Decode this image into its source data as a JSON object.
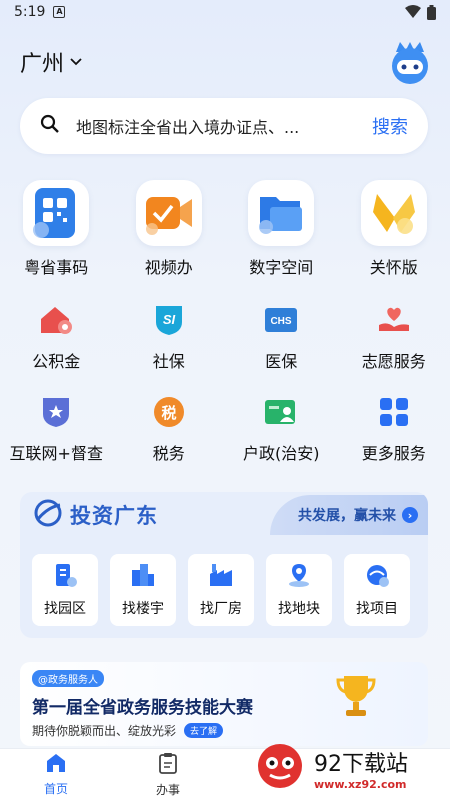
{
  "status_bar": {
    "time": "5:19",
    "notif_letter": "A"
  },
  "header": {
    "city": "广州"
  },
  "search": {
    "placeholder": "地图标注全省出入境办证点、...",
    "button": "搜索"
  },
  "main_services": [
    {
      "label": "粤省事码",
      "icon": "qr-code-icon"
    },
    {
      "label": "视频办",
      "icon": "video-icon"
    },
    {
      "label": "数字空间",
      "icon": "folder-icon"
    },
    {
      "label": "关怀版",
      "icon": "ribbon-icon"
    }
  ],
  "sub_services": [
    {
      "label": "公积金",
      "icon": "house-fund-icon"
    },
    {
      "label": "社保",
      "icon": "social-security-icon"
    },
    {
      "label": "医保",
      "icon": "medical-insurance-icon"
    },
    {
      "label": "志愿服务",
      "icon": "volunteer-icon"
    },
    {
      "label": "互联网+督查",
      "icon": "inspection-icon"
    },
    {
      "label": "税务",
      "icon": "tax-icon"
    },
    {
      "label": "户政(治安)",
      "icon": "household-icon"
    },
    {
      "label": "更多服务",
      "icon": "more-services-icon"
    }
  ],
  "icon_text": {
    "social_security": "SI",
    "medical": "CHS",
    "tax": "税"
  },
  "invest": {
    "title": "投资广东",
    "tag": "共发展，赢未来",
    "cards": [
      {
        "label": "找园区"
      },
      {
        "label": "找楼宇"
      },
      {
        "label": "找厂房"
      },
      {
        "label": "找地块"
      },
      {
        "label": "找项目"
      }
    ]
  },
  "banner": {
    "badge": "@政务服务人",
    "title": "第一届全省政务服务技能大赛",
    "subtitle": "期待你脱颖而出、绽放光彩",
    "more": "去了解"
  },
  "tabbar": {
    "home": "首页",
    "office": "办事"
  },
  "watermark": {
    "main": "92下载站",
    "url": "www.xz92.com"
  },
  "colors": {
    "accent": "#2a6ff3",
    "invest_title": "#2b5fc7",
    "fund_red": "#e8504d",
    "si_cyan": "#1aa6d9",
    "chs_blue": "#2f7fd8",
    "tax_orange": "#f08a2a",
    "house_green": "#28b36a"
  }
}
